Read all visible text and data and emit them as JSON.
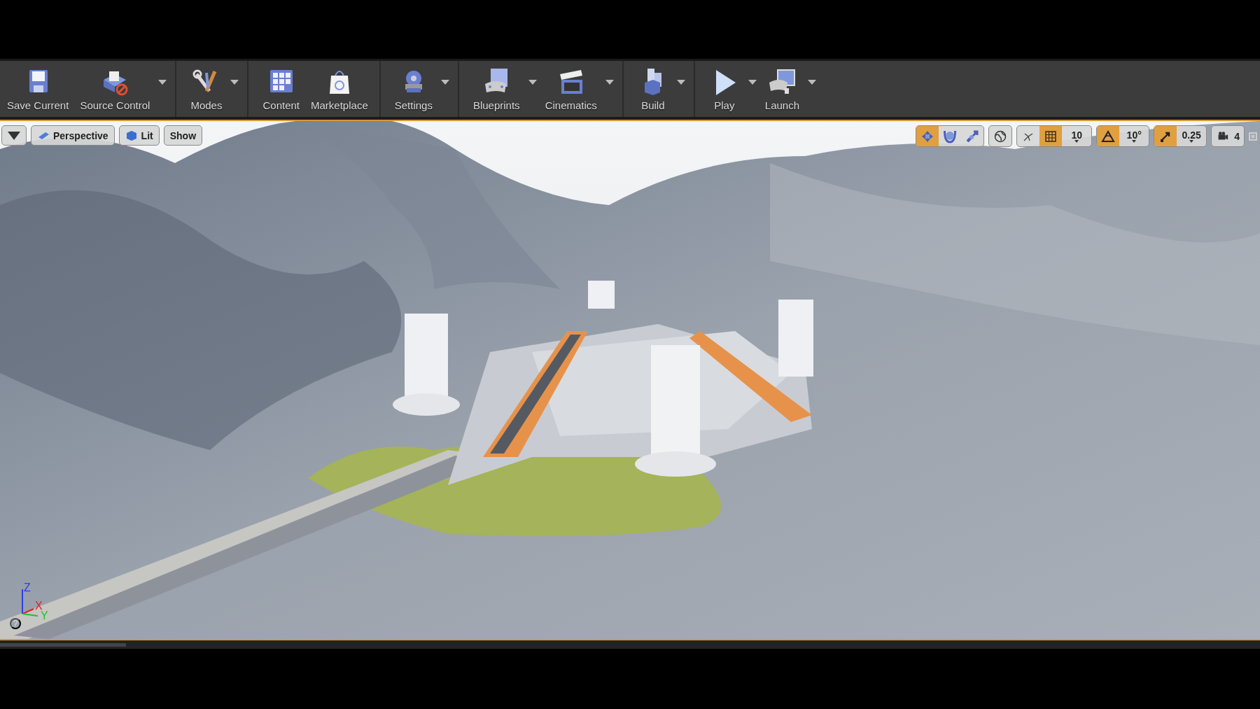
{
  "toolbar": {
    "groups": [
      [
        {
          "kind": "save",
          "label": "Save Current",
          "dropdown": false
        },
        {
          "kind": "source_control",
          "label": "Source Control",
          "dropdown": true
        }
      ],
      [
        {
          "kind": "modes",
          "label": "Modes",
          "dropdown": true
        }
      ],
      [
        {
          "kind": "content",
          "label": "Content",
          "dropdown": false
        },
        {
          "kind": "marketplace",
          "label": "Marketplace",
          "dropdown": false
        }
      ],
      [
        {
          "kind": "settings",
          "label": "Settings",
          "dropdown": true
        }
      ],
      [
        {
          "kind": "blueprints",
          "label": "Blueprints",
          "dropdown": true
        },
        {
          "kind": "cinematics",
          "label": "Cinematics",
          "dropdown": true
        }
      ],
      [
        {
          "kind": "build",
          "label": "Build",
          "dropdown": true
        }
      ],
      [
        {
          "kind": "play",
          "label": "Play",
          "dropdown": true
        },
        {
          "kind": "launch",
          "label": "Launch",
          "dropdown": true
        }
      ]
    ]
  },
  "viewport": {
    "perspective": "Perspective",
    "view_mode": "Lit",
    "show": "Show",
    "transform_tools": [
      {
        "kind": "translate",
        "selected": true
      },
      {
        "kind": "rotate",
        "selected": false
      },
      {
        "kind": "scale",
        "selected": false
      }
    ],
    "snaps": [
      {
        "kind": "grid",
        "on": true,
        "value": "10"
      },
      {
        "kind": "rotation",
        "on": true,
        "value": "10°"
      },
      {
        "kind": "scale",
        "on": true,
        "value": "0.25"
      }
    ],
    "camera_speed": "4",
    "axes": {
      "z": "Z",
      "x": "X",
      "y": "Y"
    },
    "help": "?"
  }
}
